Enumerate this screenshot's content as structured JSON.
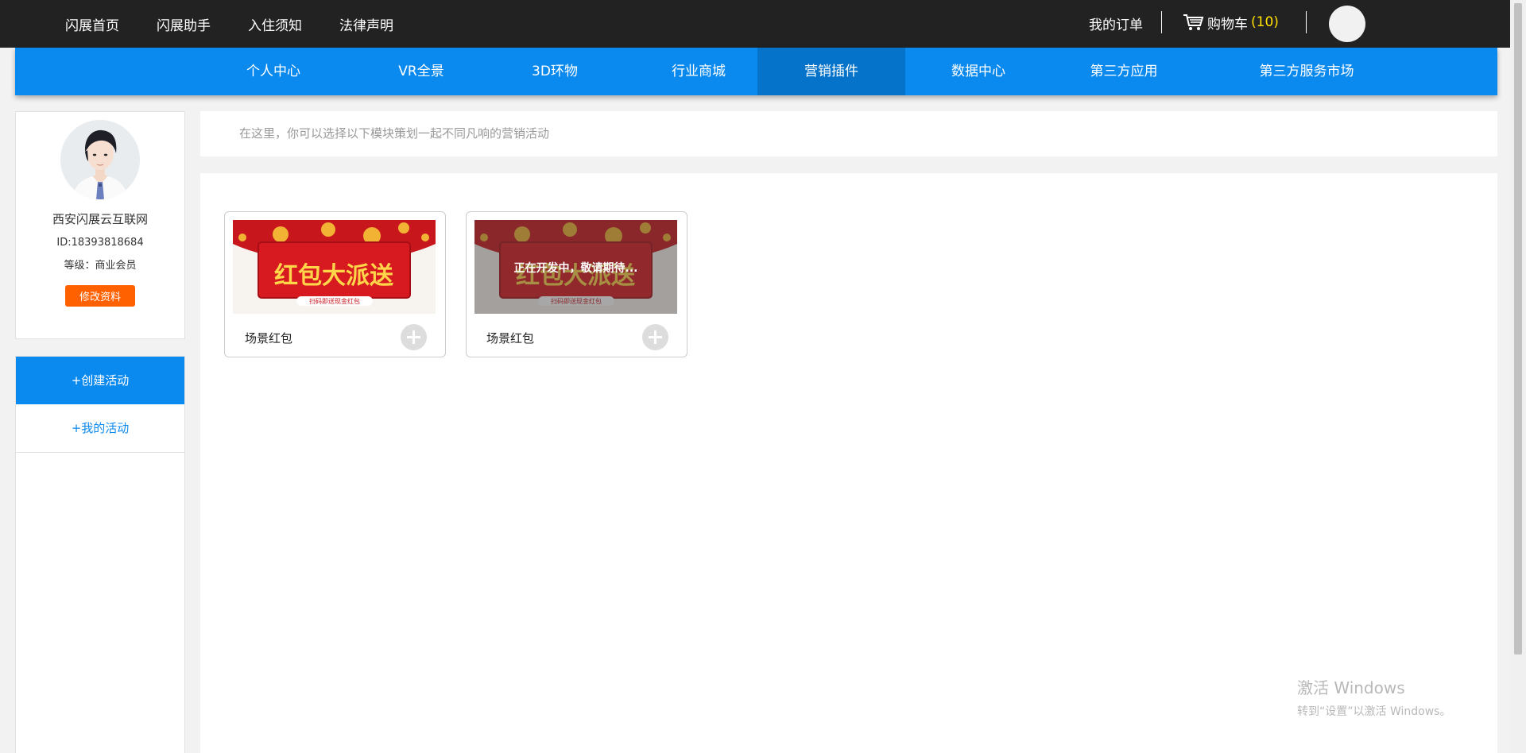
{
  "topbar": {
    "nav": [
      "闪展首页",
      "闪展助手",
      "入住须知",
      "法律声明"
    ],
    "orders_label": "我的订单",
    "cart_label": "购物车",
    "cart_count": "(10)"
  },
  "mainnav": {
    "items": [
      "个人中心",
      "VR全景",
      "3D环物",
      "行业商城",
      "营销插件",
      "数据中心",
      "第三方应用",
      "第三方服务市场"
    ],
    "active": "营销插件"
  },
  "profile": {
    "name": "西安闪展云互联网",
    "id": "ID:18393818684",
    "level": "等级：商业会员",
    "edit_label": "修改资料"
  },
  "sidebar_menu": {
    "create_label": "+创建活动",
    "mine_label": "+我的活动"
  },
  "intro_text": "在这里，你可以选择以下模块策划一起不同凡响的营销活动",
  "cards": [
    {
      "label": "场景红包",
      "banner_title": "红包大派送",
      "banner_sub": "扫码即送现金红包",
      "overlay": ""
    },
    {
      "label": "场景红包",
      "banner_title": "红包大派送",
      "banner_sub": "扫码即送现金红包",
      "overlay": "正在开发中，敬请期待..."
    }
  ],
  "watermark": {
    "line1": "激活 Windows",
    "line2": "转到“设置”以激活 Windows。"
  },
  "colors": {
    "accent": "#0a89ef",
    "active_nav": "#0473c9",
    "topbar": "#222222",
    "edit_button": "#ff6000",
    "cart_count": "#ffe000"
  }
}
